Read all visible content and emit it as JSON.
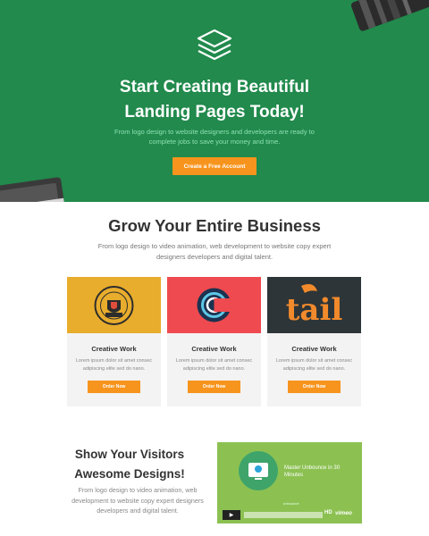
{
  "hero": {
    "title_line1": "Start Creating Beautiful",
    "title_line2": "Landing Pages Today!",
    "subtitle": "From logo design to website designers and developers are ready to complete jobs to save your money and time.",
    "cta_label": "Create a Free Account",
    "logo_icon": "layers-icon",
    "bg_color": "#218a4c",
    "cta_color": "#f7941d"
  },
  "grow": {
    "title": "Grow Your Entire Business",
    "subtitle": "From logo design to video animation, web development to website copy expert designers developers and digital talent."
  },
  "cards": [
    {
      "badge_text": "AN EVENING OF ILLUSTRATION",
      "title": "Creative Work",
      "text": "Lorem ipsum dolor sit amet consec adipiscing elite sed do nano.",
      "button": "Order Now",
      "image_bg": "#e8ad2c"
    },
    {
      "badge_text": "",
      "title": "Creative Work",
      "text": "Lorem ipsum dolor sit amet consec adipiscing elite sed do nano.",
      "button": "Order Now",
      "image_bg": "#ef4a4f"
    },
    {
      "badge_text": "tail",
      "title": "Creative Work",
      "text": "Lorem ipsum dolor sit amet consec adipiscing elite sed do nano.",
      "button": "Order Now",
      "image_bg": "#2d3538"
    }
  ],
  "show": {
    "title_line1": "Show Your Visitors",
    "title_line2": "Awesome Designs!",
    "subtitle": "From logo design to video animation, web development to website copy expert designers developers and digital talent."
  },
  "video": {
    "title": "Master Unbounce in 30 Minutes",
    "brand": "unbounce",
    "hd_label": "HD",
    "vimeo_label": "vimeo",
    "bg_color": "#8cc152"
  }
}
